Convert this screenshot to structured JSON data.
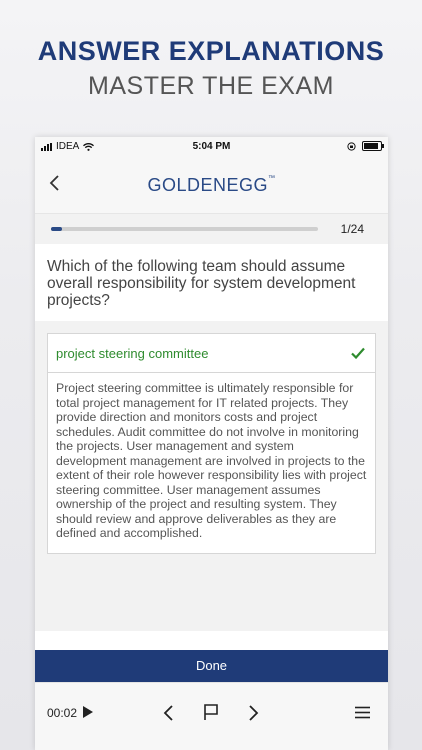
{
  "promo": {
    "title": "ANSWER EXPLANATIONS",
    "subtitle": "MASTER THE EXAM"
  },
  "status_bar": {
    "carrier": "IDEA",
    "time": "5:04 PM"
  },
  "navbar": {
    "logo_text": "GOLDENEGG",
    "logo_tm": "™",
    "back_icon": "chevron-left-icon"
  },
  "progress": {
    "counter": "1/24",
    "fraction": 0.04
  },
  "question": {
    "text": "Which of the following team should assume overall responsibility for system development projects?"
  },
  "answer": {
    "text": "project steering committee",
    "correct": true,
    "explanation": "Project steering committee is ultimately responsible for total project management for IT related projects. They provide direction and monitors costs and project schedules. Audit committee do not involve in monitoring the projects. User management and system development management are involved in projects to the extent of their role however responsibility lies with project steering committee. User management assumes ownership of the project and resulting system. They should review and approve deliverables as they are defined and accomplished."
  },
  "buttons": {
    "done_label": "Done"
  },
  "toolbar": {
    "timer": "00:02",
    "icons": [
      "play-icon",
      "chevron-left-icon",
      "flag-icon",
      "chevron-right-icon",
      "menu-icon"
    ]
  },
  "colors": {
    "brand": "#1f3b78",
    "correct": "#2e8b2e"
  }
}
